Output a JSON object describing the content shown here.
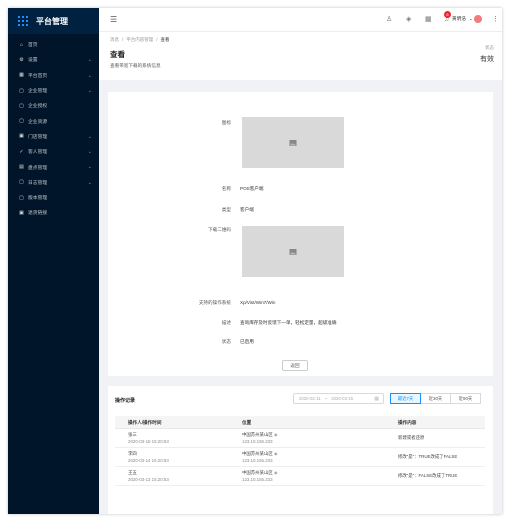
{
  "app": {
    "title": "平台管理"
  },
  "sidebar": {
    "items": [
      {
        "label": "首页",
        "icon": "home-icon",
        "glyph": "⌂",
        "has_arrow": false
      },
      {
        "label": "设置",
        "icon": "gear-icon",
        "glyph": "⚙",
        "has_arrow": true
      },
      {
        "label": "平台首页",
        "icon": "dashboard-icon",
        "glyph": "▦",
        "has_arrow": true
      },
      {
        "label": "企业管理",
        "icon": "bank-icon",
        "glyph": "▢",
        "has_arrow": true
      },
      {
        "label": "企业授权",
        "icon": "key-icon",
        "glyph": "▢",
        "has_arrow": false
      },
      {
        "label": "企业资源",
        "icon": "database-icon",
        "glyph": "▢",
        "has_arrow": false
      },
      {
        "label": "门店管理",
        "icon": "lock-icon",
        "glyph": "▣",
        "has_arrow": true
      },
      {
        "label": "客人管理",
        "icon": "check-icon",
        "glyph": "✓",
        "has_arrow": true
      },
      {
        "label": "盘点管理",
        "icon": "calendar-icon",
        "glyph": "▤",
        "has_arrow": true
      },
      {
        "label": "日志管理",
        "icon": "file-icon",
        "glyph": "▢",
        "has_arrow": true
      },
      {
        "label": "版本管理",
        "icon": "tag-icon",
        "glyph": "▢",
        "has_arrow": false
      },
      {
        "label": "退货链接",
        "icon": "link-icon",
        "glyph": "▣",
        "has_arrow": false
      }
    ]
  },
  "topbar": {
    "menu_fold_icon": "menu-fold-icon",
    "notification_count": "6",
    "user_name": "黄明浩",
    "icons": [
      "user-icon",
      "settings-icon",
      "grid-icon",
      "bell-icon"
    ]
  },
  "page_header": {
    "breadcrumb": [
      "消息",
      "/",
      "平台内容管理",
      "/",
      "查看"
    ],
    "title": "查看",
    "description": "查看带宽下载的系统信息",
    "stat_label": "状态",
    "stat_value": "有效"
  },
  "detail": {
    "fields": [
      {
        "label": "图标",
        "type": "image"
      },
      {
        "label": "名称",
        "value": "POS客户端"
      },
      {
        "label": "类型",
        "value": "客户端"
      },
      {
        "label": "下载二维码",
        "type": "image"
      },
      {
        "label": "支持的操作系统",
        "value": "Xp/Vist/Win7/Win"
      },
      {
        "label": "描述",
        "value": "查询库存及时反馈下一单，轻松定量，超级准确"
      },
      {
        "label": "状态",
        "value": "已启用"
      }
    ],
    "back_label": "返回"
  },
  "records": {
    "title": "操作记录",
    "date_start": "2020-02-11",
    "date_sep": "~",
    "date_end": "2020-03-15",
    "tabs": [
      {
        "label": "最近7天",
        "active": true
      },
      {
        "label": "近30天",
        "active": false
      },
      {
        "label": "近90天",
        "active": false
      }
    ],
    "columns": [
      "操作人/操作时间",
      "位置",
      "操作内容"
    ],
    "rows": [
      {
        "user": "张三",
        "time": "2020-03-15 15:20:53",
        "location": "中国苏州某山区",
        "ip": "123.10.155.233",
        "content": "新建或者还原"
      },
      {
        "user": "李四",
        "time": "2020-03-14 15:20:53",
        "location": "中国苏州某山区",
        "ip": "123.10.155.233",
        "content": "修改“是”：TRUE改成了FALSE"
      },
      {
        "user": "王五",
        "time": "2020-03-13 15:20:53",
        "location": "中国苏州某山区",
        "ip": "123.10.155.233",
        "content": "修改“是”：FALSE改成了TRUE"
      }
    ]
  }
}
